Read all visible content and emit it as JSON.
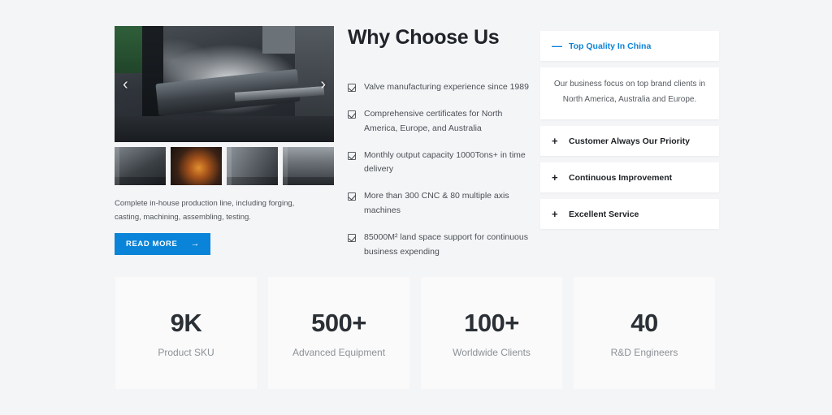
{
  "media": {
    "prev_icon": "chevron-left-icon",
    "next_icon": "chevron-right-icon",
    "thumbnails": [
      {
        "name": "factory-machining-thumb"
      },
      {
        "name": "forging-furnace-thumb"
      },
      {
        "name": "cnc-line-thumb"
      },
      {
        "name": "assembly-line-thumb"
      }
    ],
    "description": "Complete in-house production line, including forging, casting, machining, assembling, testing.",
    "read_more_label": "READ MORE",
    "read_more_arrow": "→"
  },
  "why": {
    "title": "Why Choose Us",
    "items": [
      "Valve manufacturing experience since 1989",
      "Comprehensive certificates for North America, Europe, and Australia",
      "Monthly output capacity 1000Tons+ in time delivery",
      "More than 300 CNC & 80 multiple axis machines",
      "85000M² land space support for continuous business expending"
    ]
  },
  "accordion": {
    "active_sign": "—",
    "inactive_sign": "+",
    "items": [
      {
        "label": "Top Quality In China",
        "expanded": true,
        "body": "Our business focus on top brand clients in North America, Australia and Europe."
      },
      {
        "label": "Customer Always Our Priority",
        "expanded": false,
        "body": ""
      },
      {
        "label": "Continuous Improvement",
        "expanded": false,
        "body": ""
      },
      {
        "label": "Excellent Service",
        "expanded": false,
        "body": ""
      }
    ]
  },
  "stats": [
    {
      "value": "9K",
      "label": "Product SKU"
    },
    {
      "value": "500+",
      "label": "Advanced Equipment"
    },
    {
      "value": "100+",
      "label": "Worldwide Clients"
    },
    {
      "value": "40",
      "label": "R&D Engineers"
    }
  ],
  "colors": {
    "accent": "#0a84d8",
    "page_bg": "#f4f5f7",
    "card_bg": "#ffffff",
    "stat_bg": "#fafafa",
    "heading": "#20242a"
  }
}
